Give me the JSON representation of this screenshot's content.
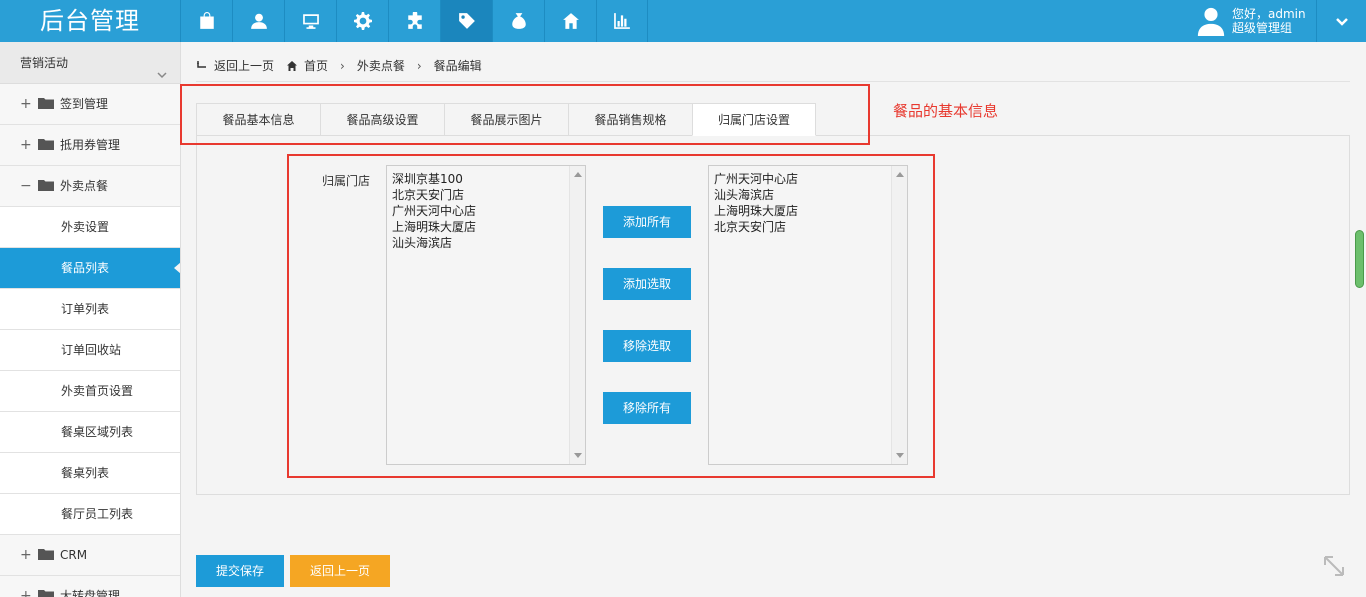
{
  "header": {
    "logo": "后台管理",
    "icons": [
      "bag-icon",
      "user-icon",
      "monitor-icon",
      "gear-icon",
      "puzzle-icon",
      "tag-icon",
      "money-bag-icon",
      "home-icon",
      "bar-chart-icon"
    ],
    "active_icon_index": 5,
    "greeting": "您好，admin",
    "role": "超级管理组"
  },
  "sidebar": {
    "section_title": "营销活动",
    "items": [
      {
        "label": "签到管理",
        "type": "group",
        "sign": "+"
      },
      {
        "label": "抵用券管理",
        "type": "group",
        "sign": "+"
      },
      {
        "label": "外卖点餐",
        "type": "group",
        "sign": "−"
      },
      {
        "label": "外卖设置",
        "type": "sub"
      },
      {
        "label": "餐品列表",
        "type": "sub",
        "active": true
      },
      {
        "label": "订单列表",
        "type": "sub"
      },
      {
        "label": "订单回收站",
        "type": "sub"
      },
      {
        "label": "外卖首页设置",
        "type": "sub"
      },
      {
        "label": "餐桌区域列表",
        "type": "sub"
      },
      {
        "label": "餐桌列表",
        "type": "sub"
      },
      {
        "label": "餐厅员工列表",
        "type": "sub"
      },
      {
        "label": "CRM",
        "type": "group",
        "sign": "+"
      },
      {
        "label": "大转盘管理",
        "type": "group",
        "sign": "+"
      }
    ]
  },
  "breadcrumb": {
    "back": "返回上一页",
    "home": "首页",
    "level1": "外卖点餐",
    "level2": "餐品编辑"
  },
  "tabs": [
    "餐品基本信息",
    "餐品高级设置",
    "餐品展示图片",
    "餐品销售规格",
    "归属门店设置"
  ],
  "annotation": "餐品的基本信息",
  "store_form": {
    "label": "归属门店",
    "available": [
      "深圳京基100",
      "北京天安门店",
      "广州天河中心店",
      "上海明珠大厦店",
      "汕头海滨店"
    ],
    "selected": [
      "广州天河中心店",
      "汕头海滨店",
      "上海明珠大厦店",
      "北京天安门店"
    ],
    "buttons": {
      "add_all": "添加所有",
      "add_selected": "添加选取",
      "remove_selected": "移除选取",
      "remove_all": "移除所有"
    }
  },
  "footer": {
    "save": "提交保存",
    "back": "返回上一页"
  },
  "colors": {
    "primary": "#2a9fd6",
    "active_blue": "#1d9bd8",
    "orange": "#f5a623",
    "annotation_red": "#e8392f"
  }
}
